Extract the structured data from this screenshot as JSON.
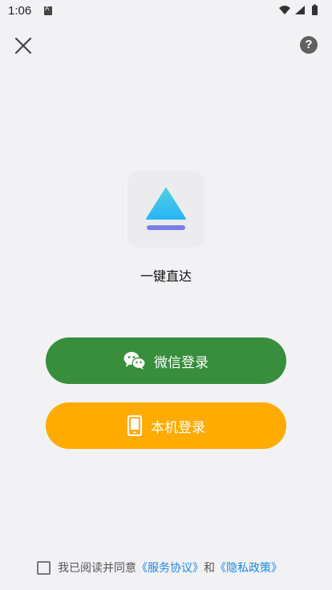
{
  "status_bar": {
    "time": "1:06"
  },
  "top_bar": {
    "close_icon": "close-icon",
    "help_label": "?"
  },
  "brand": {
    "slogan": "一键直达",
    "logo_colors": {
      "triangle_top": "#4dd0e1",
      "triangle_bottom": "#29b6f6",
      "bar": "#7b7fe8"
    }
  },
  "login": {
    "wechat_label": "微信登录",
    "wechat_icon": "wechat-icon",
    "wechat_color": "#388e3c",
    "phone_label": "本机登录",
    "phone_icon": "phone-icon",
    "phone_color": "#ffab00"
  },
  "agreement": {
    "prefix": "我已阅读并同意",
    "terms_link": "《服务协议》",
    "conjunction": "和",
    "privacy_link": "《隐私政策》",
    "checked": false
  }
}
